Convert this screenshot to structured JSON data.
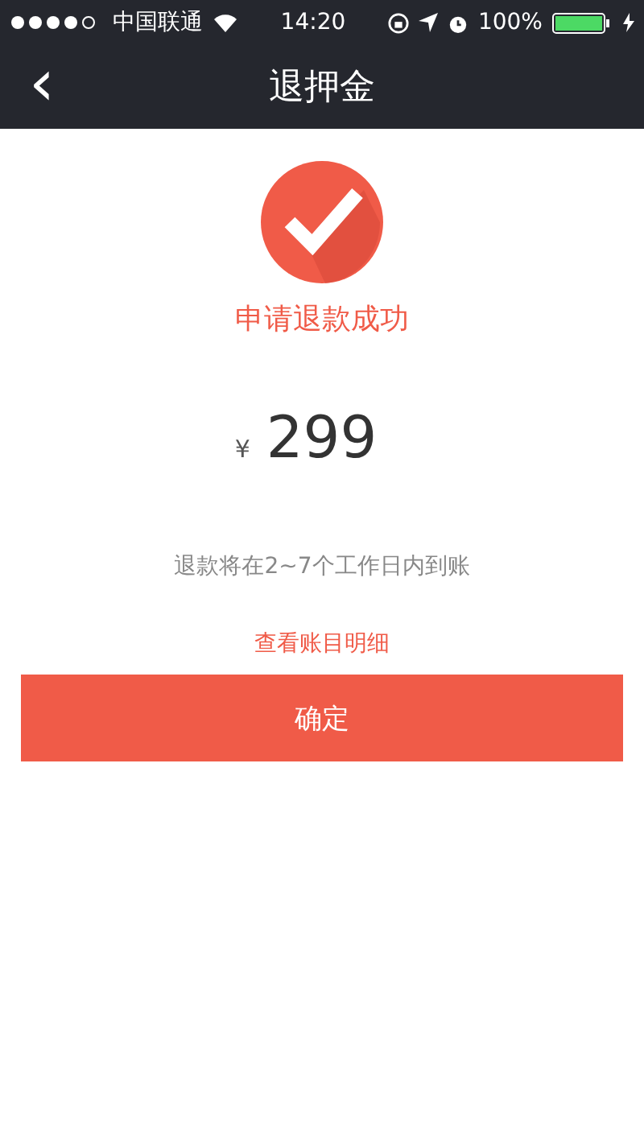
{
  "status_bar": {
    "carrier": "中国联通",
    "time": "14:20",
    "battery": "100%"
  },
  "nav": {
    "back": "‹",
    "title": "退押金"
  },
  "result": {
    "message": "申请退款成功",
    "currency": "¥",
    "amount": "299",
    "note": "退款将在2~7个工作日内到账",
    "link": "查看账目明细"
  },
  "buttons": [
    "确定"
  ]
}
